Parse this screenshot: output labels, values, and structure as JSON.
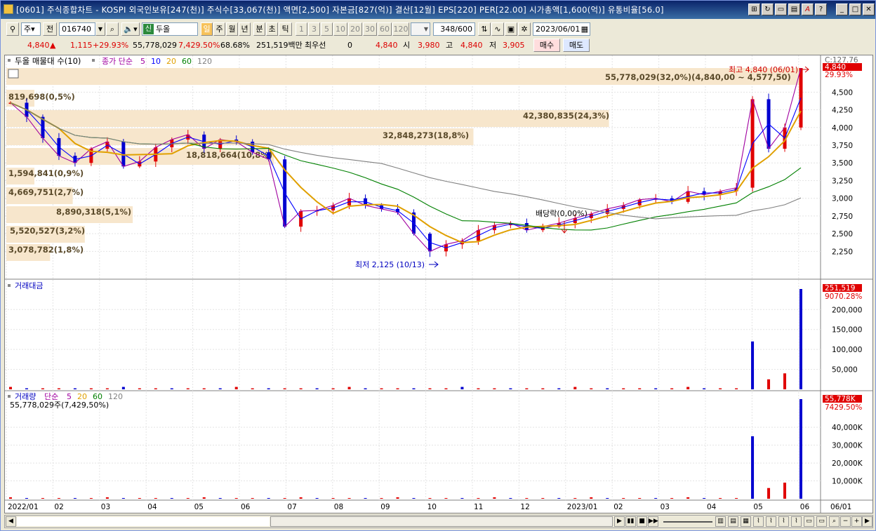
{
  "window": {
    "title": "[0601] 주식종합차트 - KOSPI 외국인보유[247(천)] 주식수[33,067(천)] 액면[2,500] 자본금[827(억)] 결산[12월] EPS[220] PER[22.00] 시가총액[1,600(억)] 유통비율[56.0]"
  },
  "toolbar": {
    "period_type": "주",
    "prev_label": "전",
    "code": "016740",
    "market_badge": "신",
    "name": "두올",
    "periods": [
      "일",
      "주",
      "월",
      "년",
      "분",
      "초",
      "틱"
    ],
    "active_period": "일",
    "intervals": [
      "1",
      "3",
      "5",
      "10",
      "20",
      "30",
      "60",
      "120"
    ],
    "count": "348",
    "max_count": "/600",
    "date": "2023/06/01"
  },
  "quote": {
    "price": "4,840",
    "arrow": "▲",
    "change": "1,115",
    "rate": "+29.93%",
    "volume": "55,778,029",
    "vol_rate": "7,429.50%",
    "turnover": "68.68%",
    "amount": "251,519백만",
    "best_label": "최우선",
    "best_value": "0",
    "ask": "4,840",
    "open_label": "시",
    "open": "3,980",
    "high_label": "고",
    "high": "4,840",
    "low_label": "저",
    "low": "3,905",
    "buy_label": "매수",
    "sell_label": "매도"
  },
  "price_panel": {
    "vp_title": "두올 매물대 수(10)",
    "ma_title": "종가 단순",
    "ma_periods": [
      "5",
      "10",
      "20",
      "60",
      "120"
    ],
    "ma_colors": [
      "#a000a0",
      "#0000ff",
      "#e0a000",
      "#008000",
      "#808080"
    ],
    "vp_labels": [
      "55,778,029(32,0%)(4,840,00 ~ 4,577,50)",
      "819,698(0,5%)",
      "42,380,835(24,3%)",
      "32,848,273(18,8%)",
      "18,818,664(10,8%)",
      "1,594,841(0,9%)",
      "4,669,751(2,7%)",
      "8,890,318(5,1%)",
      "5,520,527(3,2%)",
      "3,078,782(1,8%)"
    ],
    "high_note": "최고 4,840 (06/01)",
    "low_note": "최저 2,125 (10/13)",
    "dividend_note": "배당락(0,00%)",
    "axis_top": "C:127.76",
    "last_price_tag": "4,840",
    "last_rate_tag": "29.93%",
    "y_ticks": [
      "4,500",
      "4,250",
      "4,000",
      "3,750",
      "3,500",
      "3,250",
      "3,000",
      "2,750",
      "2,500",
      "2,250"
    ]
  },
  "amount_panel": {
    "title": "거래대금",
    "last_tag": "251,519",
    "rate_tag": "9070.28%",
    "y_ticks": [
      "200,000",
      "150,000",
      "100,000",
      "50,000"
    ]
  },
  "volume_panel": {
    "title": "거래량",
    "ma_title": "단순",
    "ma_periods": [
      "5",
      "20",
      "60",
      "120"
    ],
    "ma_colors": [
      "#a000a0",
      "#e0a000",
      "#008000",
      "#808080"
    ],
    "info": "55,778,029주(7,429,50%)",
    "last_tag": "55,778K",
    "rate_tag": "7429.50%",
    "y_ticks": [
      "40,000K",
      "30,000K",
      "20,000K",
      "10,000K"
    ]
  },
  "x_axis": {
    "labels": [
      "2022/01",
      "02",
      "03",
      "04",
      "05",
      "06",
      "07",
      "08",
      "09",
      "10",
      "11",
      "12",
      "2023/01",
      "02",
      "03",
      "04",
      "05",
      "06",
      "06/01"
    ]
  },
  "chart_data": {
    "type": "candlestick",
    "symbol": "016740",
    "name": "두올",
    "y_range": [
      2125,
      4840
    ],
    "last_close": 4840,
    "high": {
      "value": 4840,
      "date": "06/01"
    },
    "low": {
      "value": 2125,
      "date": "10/13"
    },
    "volume_profile": [
      {
        "volume": 55778029,
        "pct": 32.0,
        "range": [
          4577.5,
          4840.0
        ]
      },
      {
        "volume": 819698,
        "pct": 0.5
      },
      {
        "volume": 42380835,
        "pct": 24.3
      },
      {
        "volume": 32848273,
        "pct": 18.8
      },
      {
        "volume": 18818664,
        "pct": 10.8
      },
      {
        "volume": 1594841,
        "pct": 0.9
      },
      {
        "volume": 4669751,
        "pct": 2.7
      },
      {
        "volume": 8890318,
        "pct": 5.1
      },
      {
        "volume": 5520527,
        "pct": 3.2
      },
      {
        "volume": 3078782,
        "pct": 1.8
      }
    ],
    "approx_closes": [
      4350,
      4150,
      3850,
      3600,
      3500,
      3700,
      3800,
      3450,
      3520,
      3720,
      3830,
      3900,
      3700,
      3830,
      3800,
      3650,
      3550,
      2600,
      2820,
      2830,
      2900,
      3000,
      2900,
      2850,
      2800,
      2500,
      2250,
      2350,
      2400,
      2550,
      2620,
      2650,
      2550,
      2600,
      2650,
      2720,
      2780,
      2850,
      2900,
      2980,
      3000,
      2950,
      3100,
      3050,
      3100,
      3150,
      4400,
      3700,
      4000,
      4840
    ],
    "last_volume": 55778029,
    "last_amount_million": 251519
  }
}
